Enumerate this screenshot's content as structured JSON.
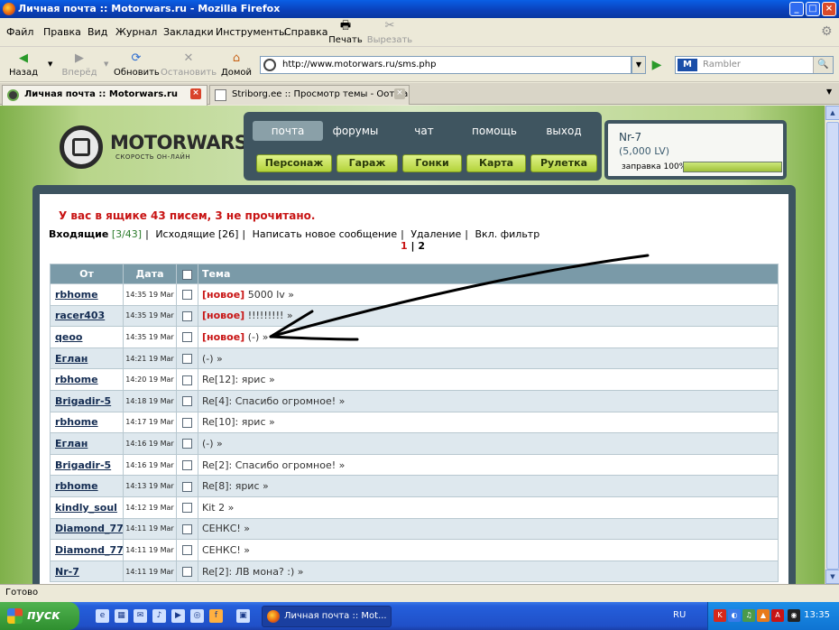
{
  "window": {
    "title": "Личная почта :: Motorwars.ru - Mozilla Firefox"
  },
  "menu": [
    "Файл",
    "Правка",
    "Вид",
    "Журнал",
    "Закладки",
    "Инструменты",
    "Справка"
  ],
  "toolbar1": {
    "print": "Печать",
    "cut": "Вырезать"
  },
  "nav": {
    "back": "Назад",
    "forward": "Вперёд",
    "reload": "Обновить",
    "stop": "Остановить",
    "home": "Домой"
  },
  "url": "http://www.motorwars.ru/sms.php",
  "search": {
    "engine": "M",
    "placeholder": "Rambler"
  },
  "tabs": [
    {
      "label": "Личная почта :: Motorwars.ru"
    },
    {
      "label": "Striborg.ee :: Просмотр темы - Oот та..."
    }
  ],
  "site": {
    "logo": "MOTORWARS.RU",
    "tagline": "СКОРОСТЬ ОН-ЛАЙН",
    "top_nav": [
      "почта",
      "форумы",
      "чат",
      "помощь",
      "выход"
    ],
    "sub_nav": [
      "Персонаж",
      "Гараж",
      "Гонки",
      "Карта",
      "Рулетка"
    ],
    "user": {
      "name": "Nr-7",
      "level": "(5,000 LV)",
      "fuel_label": "заправка 100%",
      "fuel_percent": 100
    }
  },
  "mail": {
    "notice": "У вас в ящике 43 писем, 3 не прочитано.",
    "inbox_label": "Входящие",
    "inbox_count": "[3/43]",
    "outbox_label": "Исходящие [26]",
    "compose": "Написать новое сообщение",
    "delete": "Удаление",
    "filter": "Вкл. фильтр",
    "page_current": "1",
    "page_sep": "|",
    "page_next": "2",
    "columns": {
      "from": "От",
      "date": "Дата",
      "subject": "Тема"
    },
    "rows": [
      {
        "from": "rbhome",
        "date": "14:35 19 Mar",
        "new": "[новое]",
        "subject": "5000 lv »"
      },
      {
        "from": "racer403",
        "date": "14:35 19 Mar",
        "new": "[новое]",
        "subject": "!!!!!!!!! »"
      },
      {
        "from": "qeoo",
        "date": "14:35 19 Mar",
        "new": "[новое]",
        "subject": "(-) »"
      },
      {
        "from": "Еглан",
        "date": "14:21 19 Mar",
        "new": "",
        "subject": "(-) »"
      },
      {
        "from": "rbhome",
        "date": "14:20 19 Mar",
        "new": "",
        "subject": "Re[12]: ярис »"
      },
      {
        "from": "Brigadir-5",
        "date": "14:18 19 Mar",
        "new": "",
        "subject": "Re[4]: Спасибо огромное! »"
      },
      {
        "from": "rbhome",
        "date": "14:17 19 Mar",
        "new": "",
        "subject": "Re[10]: ярис »"
      },
      {
        "from": "Еглан",
        "date": "14:16 19 Mar",
        "new": "",
        "subject": "(-) »"
      },
      {
        "from": "Brigadir-5",
        "date": "14:16 19 Mar",
        "new": "",
        "subject": "Re[2]: Спасибо огромное! »"
      },
      {
        "from": "rbhome",
        "date": "14:13 19 Mar",
        "new": "",
        "subject": "Re[8]: ярис »"
      },
      {
        "from": "kindly_soul",
        "date": "14:12 19 Mar",
        "new": "",
        "subject": "Kit 2 »"
      },
      {
        "from": "Diamond_77",
        "date": "14:11 19 Mar",
        "new": "",
        "subject": "СЕНКС! »"
      },
      {
        "from": "Diamond_77",
        "date": "14:11 19 Mar",
        "new": "",
        "subject": "СЕНКС! »"
      },
      {
        "from": "Nr-7",
        "date": "14:11 19 Mar",
        "new": "",
        "subject": "Re[2]: ЛВ мона? :) »"
      }
    ]
  },
  "status": "Готово",
  "taskbar": {
    "start": "пуск",
    "task": "Личная почта :: Mot...",
    "lang": "RU",
    "clock": "13:35"
  }
}
